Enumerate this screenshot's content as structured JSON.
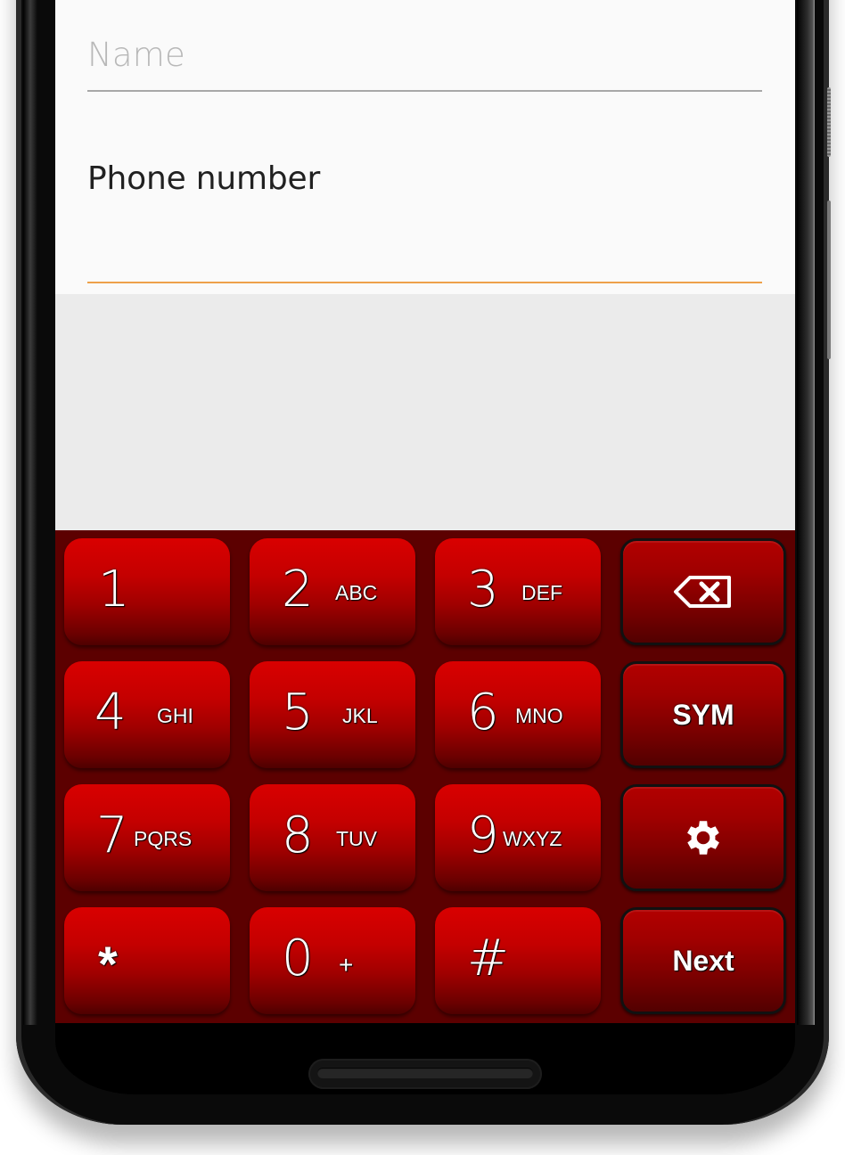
{
  "form": {
    "name_field": {
      "placeholder": "Name",
      "value": ""
    },
    "phone_field": {
      "label": "Phone number",
      "value": ""
    }
  },
  "keyboard": {
    "keys": [
      {
        "id": "key-1",
        "digit": "1",
        "letters": ""
      },
      {
        "id": "key-2",
        "digit": "2",
        "letters": "ABC"
      },
      {
        "id": "key-3",
        "digit": "3",
        "letters": "DEF"
      },
      {
        "id": "key-4",
        "digit": "4",
        "letters": "GHI"
      },
      {
        "id": "key-5",
        "digit": "5",
        "letters": "JKL"
      },
      {
        "id": "key-6",
        "digit": "6",
        "letters": "MNO"
      },
      {
        "id": "key-7",
        "digit": "7",
        "letters": "PQRS"
      },
      {
        "id": "key-8",
        "digit": "8",
        "letters": "TUV"
      },
      {
        "id": "key-9",
        "digit": "9",
        "letters": "WXYZ"
      },
      {
        "id": "key-star",
        "digit": "*",
        "letters": ""
      },
      {
        "id": "key-0",
        "digit": "0",
        "letters": "+"
      },
      {
        "id": "key-hash",
        "digit": "#",
        "letters": ""
      }
    ],
    "function_keys": {
      "backspace": {
        "icon": "backspace-icon"
      },
      "symbols": {
        "label": "SYM"
      },
      "settings": {
        "icon": "gear-icon"
      },
      "next": {
        "label": "Next"
      }
    }
  },
  "colors": {
    "key_red": "#d90000",
    "keyboard_bg": "#5c0000",
    "focus_underline": "#eea14a",
    "form_bg": "#fafafa",
    "empty_area_bg": "#ebebeb"
  }
}
